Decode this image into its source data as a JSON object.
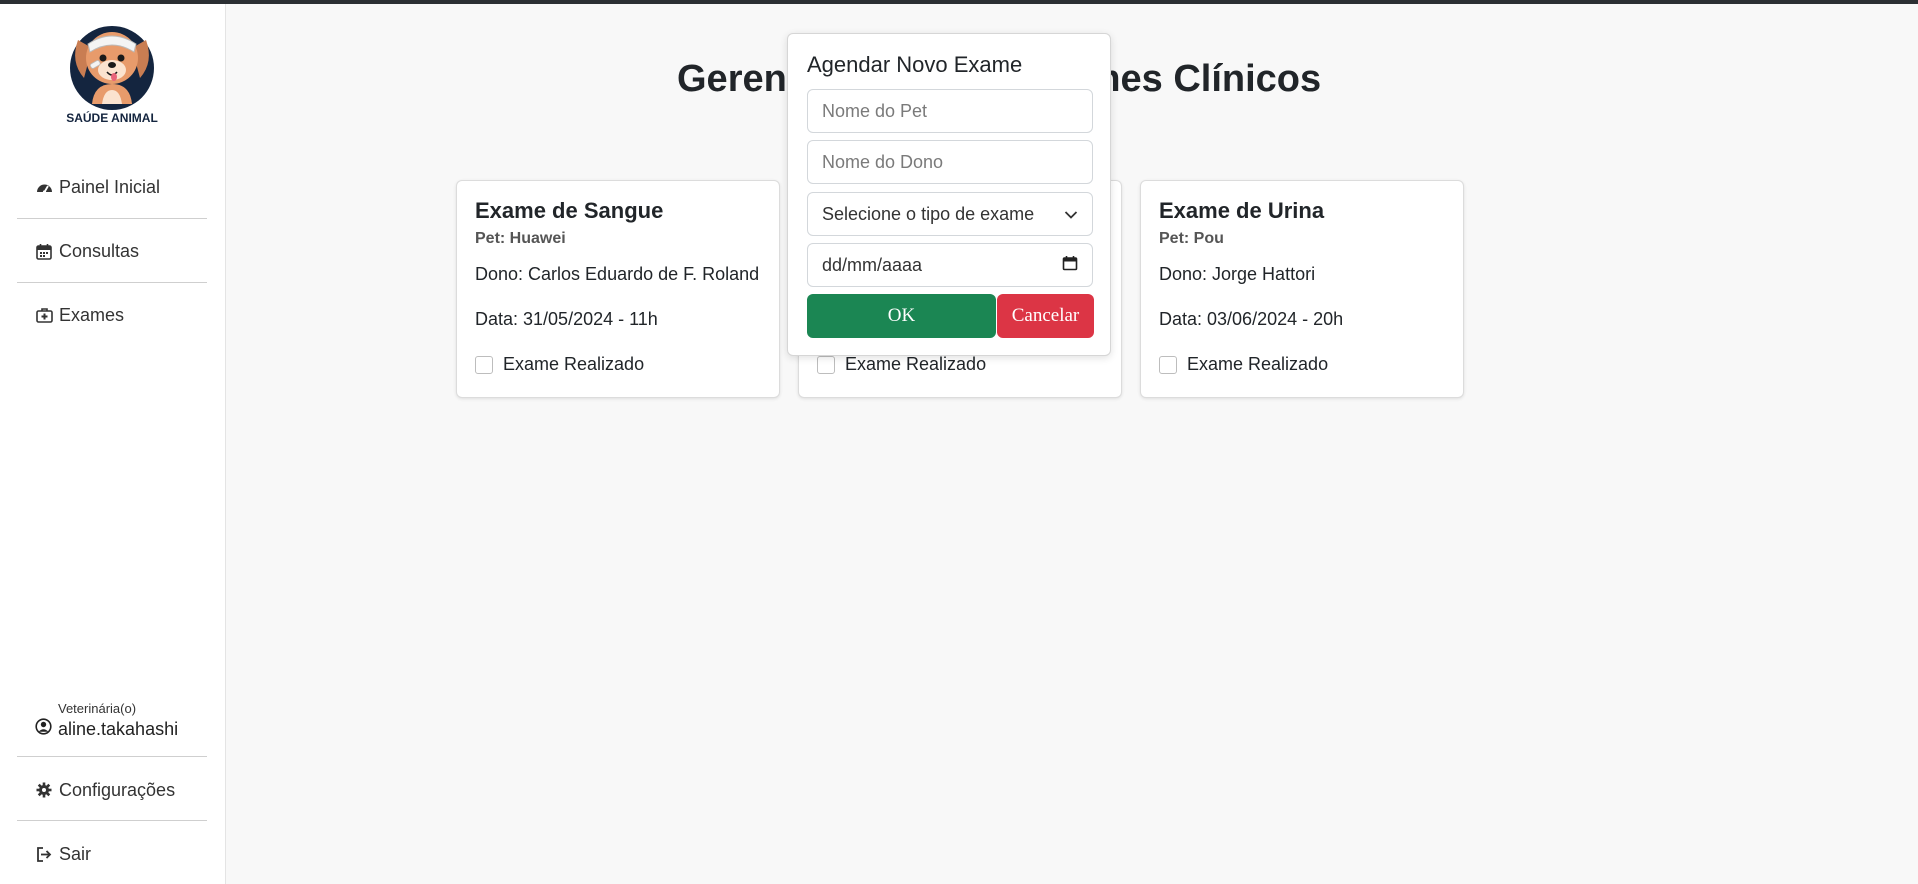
{
  "brand": {
    "logo_text": "SAÚDE ANIMAL",
    "logo_icon": "bandaged-dog-logo"
  },
  "sidebar": {
    "items": [
      {
        "label": "Painel Inicial",
        "icon": "dashboard-icon"
      },
      {
        "label": "Consultas",
        "icon": "calendar-icon"
      },
      {
        "label": "Exames",
        "icon": "medkit-icon"
      }
    ],
    "user": {
      "role": "Veterinária(o)",
      "name": "aline.takahashi",
      "icon": "user-circle-icon"
    },
    "settings_label": "Configurações",
    "logout_label": "Sair"
  },
  "main": {
    "title": "Gerenciamento de Exames Clínicos",
    "title_visible_left": "Gerenc",
    "title_visible_right": "Clínicos",
    "checkbox_label": "Exame Realizado",
    "cards": [
      {
        "title": "Exame de Sangue",
        "pet": "Pet: Huawei",
        "owner": "Dono: Carlos Eduardo de F. Roland",
        "date": "Data: 31/05/2024 - 11h",
        "done_label": "Exame Realizado"
      },
      {
        "title": "",
        "pet": "",
        "owner": "",
        "date": "",
        "done_label": "Exame Realizado"
      },
      {
        "title": "Exame de Urina",
        "pet": "Pet: Pou",
        "owner": "Dono: Jorge Hattori",
        "date": "Data: 03/06/2024 - 20h",
        "done_label": "Exame Realizado"
      }
    ]
  },
  "modal": {
    "title": "Agendar Novo Exame",
    "pet_placeholder": "Nome do Pet",
    "owner_placeholder": "Nome do Dono",
    "exam_type_selected": "Selecione o tipo de exame",
    "date_placeholder": "dd/mm/aaaa",
    "ok_label": "OK",
    "cancel_label": "Cancelar"
  },
  "colors": {
    "ok_button": "#1b8653",
    "cancel_button": "#dc3545",
    "background": "#f8f8f8"
  }
}
